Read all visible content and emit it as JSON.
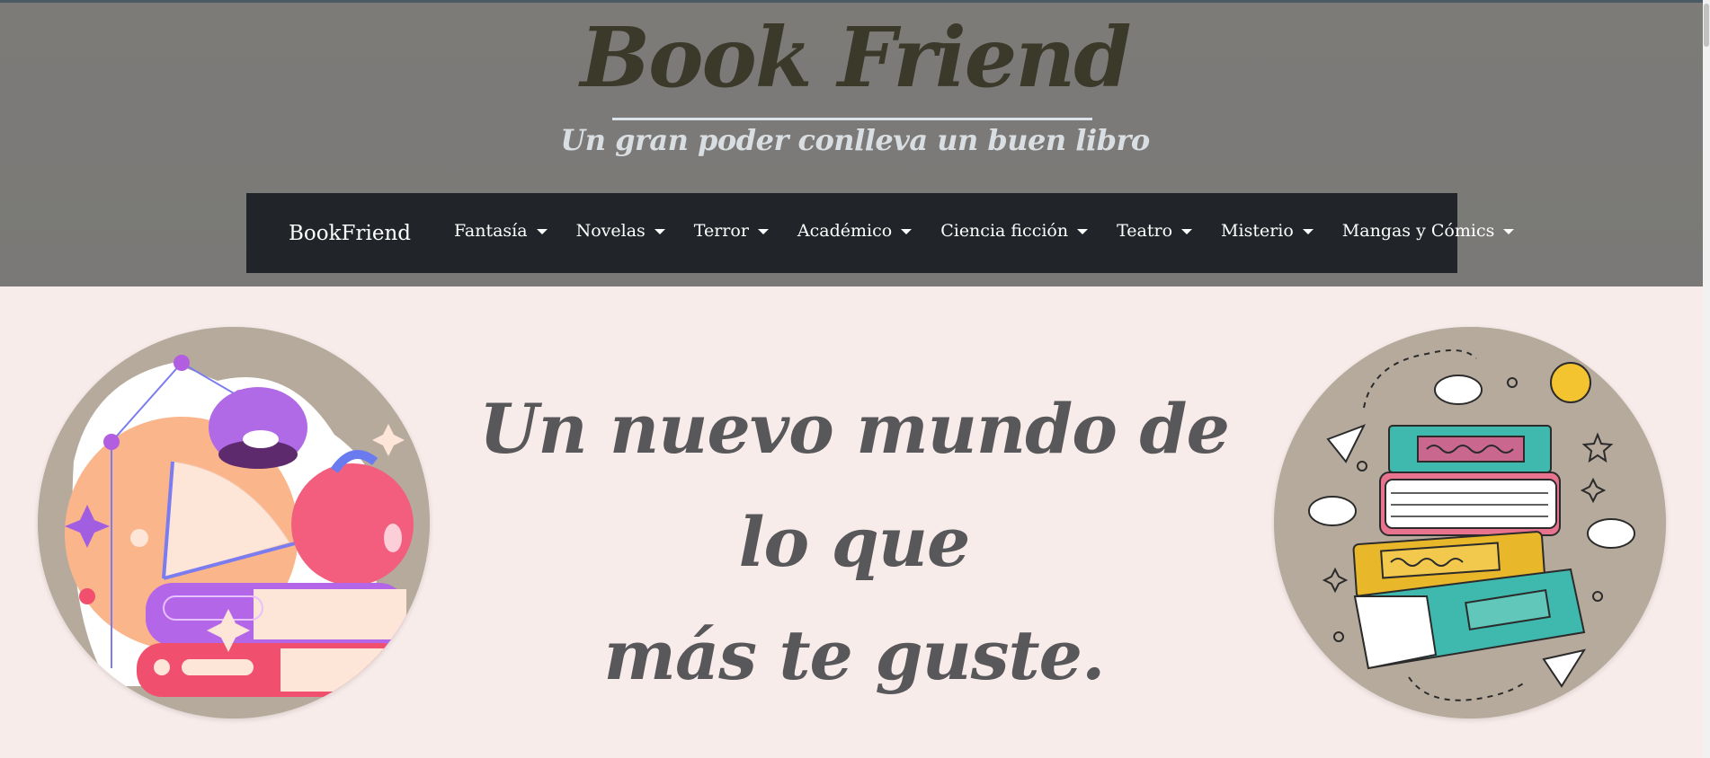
{
  "header": {
    "title": "Book Friend",
    "tagline": "Un gran poder conlleva un buen libro"
  },
  "navbar": {
    "brand": "BookFriend",
    "items": [
      {
        "label": "Fantasía"
      },
      {
        "label": "Novelas"
      },
      {
        "label": "Terror"
      },
      {
        "label": "Académico"
      },
      {
        "label": "Ciencia ficción"
      },
      {
        "label": "Teatro"
      },
      {
        "label": "Misterio"
      },
      {
        "label": "Mangas y Cómics"
      }
    ]
  },
  "hero": {
    "line1": "Un nuevo mundo de lo que",
    "line2": "más te guste."
  },
  "colors": {
    "header_bg": "#7b7a78",
    "navbar_bg": "#212529",
    "page_bg": "#f8ecea",
    "title_color": "#3b3a2a",
    "hero_text": "#58575a",
    "circle_bg": "#b6aa9c"
  },
  "images": {
    "left": "books-apple-lamp-illustration",
    "right": "stacked-books-doodle-illustration"
  }
}
